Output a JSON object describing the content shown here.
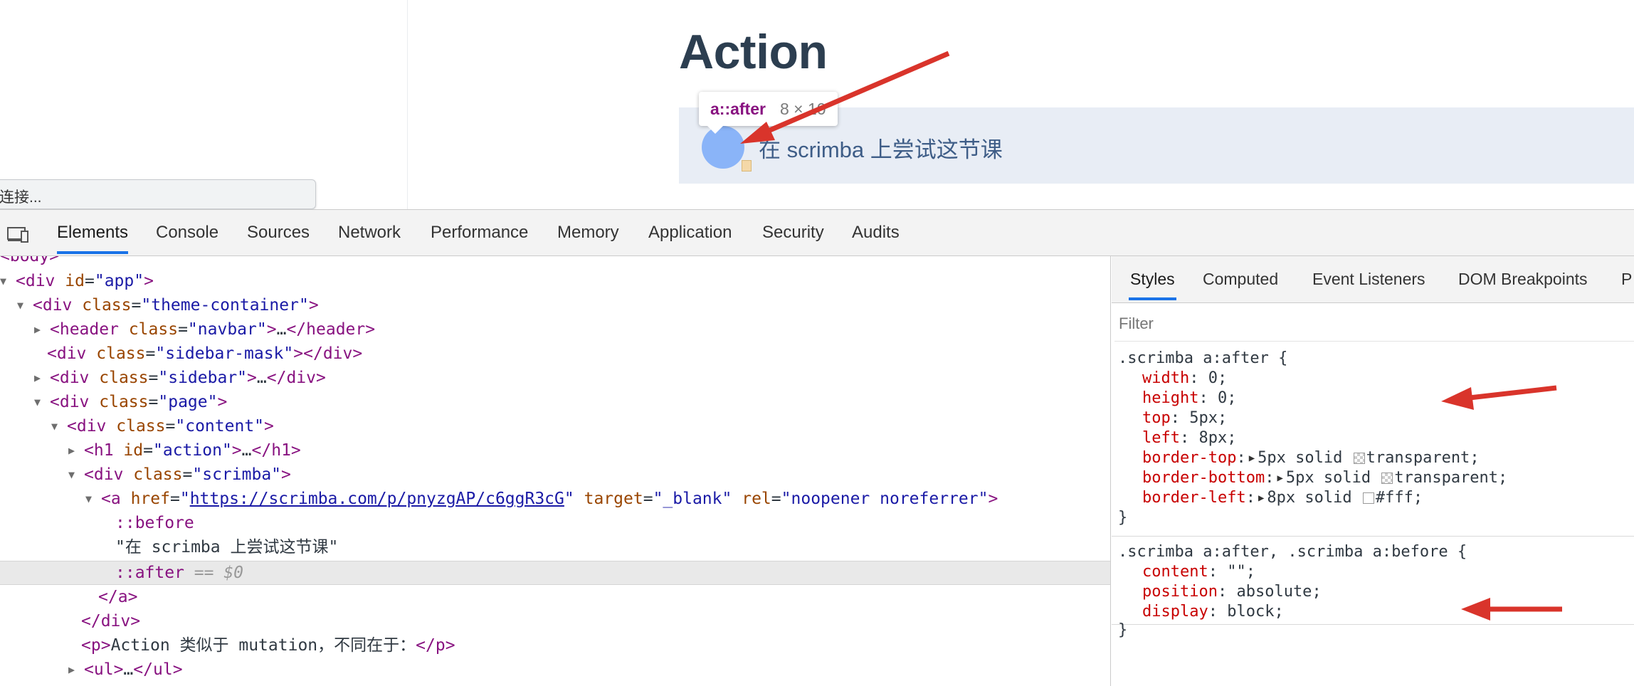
{
  "page": {
    "heading": "Action",
    "scrimba_link_text": "在 scrimba 上尝试这节课",
    "status_text": "连接..."
  },
  "tooltip": {
    "tag": "a::after",
    "dimensions": "8 × 10"
  },
  "devtools": {
    "tabs": [
      "Elements",
      "Console",
      "Sources",
      "Network",
      "Performance",
      "Memory",
      "Application",
      "Security",
      "Audits"
    ],
    "active_tab": "Elements",
    "device_toggle_icon": "device-toolbar-icon"
  },
  "tree": {
    "body": "body",
    "app_tag": "div",
    "app_attr": "id",
    "app_val": "app",
    "theme_tag": "div",
    "theme_attr": "class",
    "theme_val": "theme-container",
    "header_tag": "header",
    "header_attr": "class",
    "header_val": "navbar",
    "header_close": "header",
    "mask_tag": "div",
    "mask_attr": "class",
    "mask_val": "sidebar-mask",
    "mask_close": "div",
    "sidebar_tag": "div",
    "sidebar_attr": "class",
    "sidebar_val": "sidebar",
    "sidebar_close": "div",
    "page_tag": "div",
    "page_attr": "class",
    "page_val": "page",
    "content_tag": "div",
    "content_attr": "class",
    "content_val": "content",
    "h1_tag": "h1",
    "h1_attr": "id",
    "h1_val": "action",
    "h1_close": "h1",
    "scrimba_tag": "div",
    "scrimba_attr": "class",
    "scrimba_val": "scrimba",
    "a_tag": "a",
    "a_href_attr": "href",
    "a_href": "https://scrimba.com/p/pnyzgAP/c6ggR3cG",
    "a_target_attr": "target",
    "a_target": "_blank",
    "a_rel_attr": "rel",
    "a_rel": "noopener noreferrer",
    "before": "::before",
    "text_node": "\"在 scrimba 上尝试这节课\"",
    "after": "::after",
    "after_marker": "== $0",
    "a_close": "a",
    "scrimba_close": "div",
    "p_tag": "p",
    "p_text": "Action 类似于 mutation，不同在于：",
    "p_close": "p",
    "ul_tag": "ul",
    "ul_close": "ul",
    "ellipsis": "…"
  },
  "styles": {
    "tabs": [
      "Styles",
      "Computed",
      "Event Listeners",
      "DOM Breakpoints",
      "P"
    ],
    "active_tab": "Styles",
    "filter_placeholder": "Filter",
    "rule1": {
      "selector": ".scrimba a:after",
      "props": [
        {
          "name": "width",
          "value": "0"
        },
        {
          "name": "height",
          "value": "0"
        },
        {
          "name": "top",
          "value": "5px"
        },
        {
          "name": "left",
          "value": "8px"
        },
        {
          "name": "border-top",
          "value": "5px solid",
          "color": "transparent"
        },
        {
          "name": "border-bottom",
          "value": "5px solid",
          "color": "transparent"
        },
        {
          "name": "border-left",
          "value": "8px solid",
          "color": "#fff"
        }
      ]
    },
    "rule2": {
      "selector": ".scrimba a:after, .scrimba a:before",
      "props": [
        {
          "name": "content",
          "value": "\"\""
        },
        {
          "name": "position",
          "value": "absolute"
        },
        {
          "name": "display",
          "value": "block"
        }
      ]
    }
  },
  "annotation_color": "#d9342b"
}
